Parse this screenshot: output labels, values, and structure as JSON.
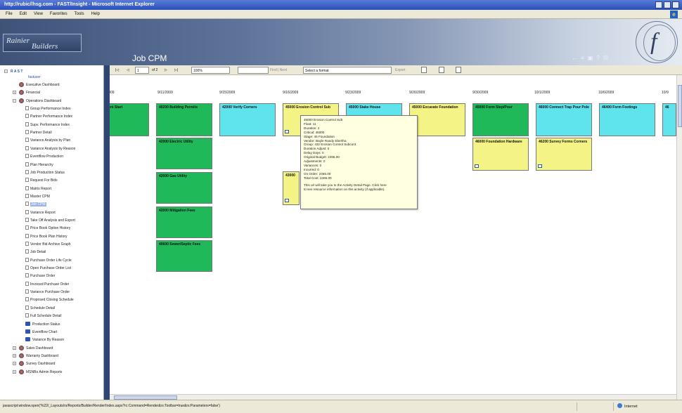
{
  "window": {
    "title": "http://rubic/lhsg.com - FAST/Insight - Microsoft Internet Explorer"
  },
  "menu": [
    "File",
    "Edit",
    "View",
    "Favorites",
    "Tools",
    "Help"
  ],
  "header": {
    "logo_line1": "Rainier",
    "logo_line2": "Builders",
    "page_title": "Job CPM",
    "tools": [
      "←",
      "≡",
      "▣",
      "?",
      "☒"
    ]
  },
  "toolbar": {
    "first": "|◁",
    "prev": "◁",
    "page": "1",
    "of": "of 2",
    "next": "▷",
    "last": "▷|",
    "zoom": "100%",
    "find_link": "Find | Next",
    "format": "Select a format",
    "export": "Export"
  },
  "sidebar": {
    "root": "R A S T",
    "user": "fastuser",
    "items": [
      {
        "label": "Executive Dashboard",
        "icon": "dashboard-icon"
      },
      {
        "label": "Financial",
        "icon": "dashboard-icon"
      },
      {
        "label": "Operations Dashboard",
        "icon": "dashboard-icon"
      },
      {
        "label": "Group Performance Index",
        "icon": "report-icon"
      },
      {
        "label": "Partner Performance Index",
        "icon": "report-icon"
      },
      {
        "label": "Supv. Performance Index",
        "icon": "report-icon"
      },
      {
        "label": "Partner Detail",
        "icon": "report-icon"
      },
      {
        "label": "Variance Analysis by Plan",
        "icon": "report-icon"
      },
      {
        "label": "Variance Analysis by Reason",
        "icon": "report-icon"
      },
      {
        "label": "Eventflow Production",
        "icon": "report-icon"
      },
      {
        "label": "Plan Hierarchy",
        "icon": "report-icon"
      },
      {
        "label": "Job Production Status",
        "icon": "report-icon"
      },
      {
        "label": "Request For Bids",
        "icon": "report-icon"
      },
      {
        "label": "Matrix Report",
        "icon": "report-icon"
      },
      {
        "label": "Master CPM",
        "icon": "report-icon"
      },
      {
        "label": "Job CPM",
        "icon": "report-icon"
      },
      {
        "label": "Variance Report",
        "icon": "report-icon"
      },
      {
        "label": "Take Off Analysis and Export",
        "icon": "report-icon"
      },
      {
        "label": "Price Book Option History",
        "icon": "report-icon"
      },
      {
        "label": "Price Book Plan History",
        "icon": "report-icon"
      },
      {
        "label": "Vendor Bid Archive Graph",
        "icon": "report-icon"
      },
      {
        "label": "Job Detail",
        "icon": "report-icon"
      },
      {
        "label": "Purchase Order Life Cycle",
        "icon": "report-icon"
      },
      {
        "label": "Open Purchase Order List",
        "icon": "report-icon"
      },
      {
        "label": "Purchase Order",
        "icon": "report-icon"
      },
      {
        "label": "Invoiced Purchase Order",
        "icon": "report-icon"
      },
      {
        "label": "Variance Purchase Order",
        "icon": "report-icon"
      },
      {
        "label": "Proposed Closing Schedule",
        "icon": "report-icon"
      },
      {
        "label": "Schedule Detail",
        "icon": "report-icon"
      },
      {
        "label": "Full Schedule Detail",
        "icon": "report-icon"
      },
      {
        "label": "Production Status",
        "icon": "chart-icon"
      },
      {
        "label": "Eventflow Chart",
        "icon": "chart-icon"
      },
      {
        "label": "Variance By Reason",
        "icon": "chart-icon"
      },
      {
        "label": "Sales Dashboard",
        "icon": "dashboard-icon"
      },
      {
        "label": "Warranty Dashboard",
        "icon": "dashboard-icon"
      },
      {
        "label": "Survey Dashboard",
        "icon": "dashboard-icon"
      },
      {
        "label": "MSNBo Admin Reports",
        "icon": "dashboard-icon"
      }
    ]
  },
  "cpm": {
    "dates": [
      "/2009",
      "9/11/2009",
      "9/15/2009",
      "9/16/2009",
      "9/23/2009",
      "9/26/2009",
      "9/30/2009",
      "10/1/2009",
      "10/6/2009",
      "10/9"
    ],
    "cards": [
      {
        "text": "ent Start",
        "color": "green"
      },
      {
        "text": "40200 Building Permits",
        "color": "green"
      },
      {
        "text": "42000 Electric Utility",
        "color": "green"
      },
      {
        "text": "42000 Gas Utility",
        "color": "green"
      },
      {
        "text": "42000 Mitigation Fees",
        "color": "green"
      },
      {
        "text": "40600 Sewer/Septic Fees",
        "color": "green"
      },
      {
        "text": "42000 Verify Corners",
        "color": "cyan"
      },
      {
        "text": "45000 Erosion Control Sub",
        "color": "yellow"
      },
      {
        "text": "43000",
        "color": "yellow"
      },
      {
        "text": "45000 Stake House",
        "color": "cyan"
      },
      {
        "text": "45000 Excavate Foundation",
        "color": "yellow"
      },
      {
        "text": "45000 Form Step/Pour",
        "color": "green"
      },
      {
        "text": "46000 Foundation Hardware",
        "color": "yellow"
      },
      {
        "text": "46000 Connect Trap Pour Pole",
        "color": "cyan"
      },
      {
        "text": "46200 Survey Forms Corners",
        "color": "yellow"
      },
      {
        "text": "46400 Form Footings",
        "color": "cyan"
      },
      {
        "text": "46",
        "color": "cyan"
      }
    ],
    "tooltip": [
      "45000 Erosion Control Sub",
      "Float: 11",
      "Duration: 2",
      "Critical: 45000",
      "Stage: 45 Foundation",
      "Vendor: Bayle Randy Ebertha",
      "Group: 432 Erosion Control Subcont",
      "Duration Adjust: 0",
      "Delay Days: 0",
      "Original Budget: 2465.00",
      "Adjustments: 0",
      "Variances: 0",
      "Incurred: 0",
      "On Order: 2465.00",
      "Total Cost: 2465.00",
      "",
      "This url will take you to the Activity Detail Page.  Click here",
      "to see resource information on this activity (if applicable)."
    ]
  },
  "status": {
    "url": "javascript:window.open('%22/_Layouts/rs/Reports/Builder/Render/Index.aspx?rc:Command=Render&rs:Toolbar=true&rs:Parameters=false')",
    "zone": "Internet"
  },
  "colors": {
    "green": "#1fb95a",
    "cyan": "#5fe4ee",
    "yellow": "#f4f486",
    "navy": "#2f4672"
  }
}
